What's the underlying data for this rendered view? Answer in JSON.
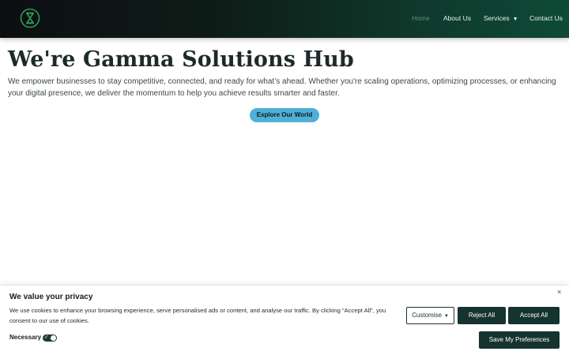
{
  "header": {
    "nav": [
      {
        "label": "Home",
        "active": true
      },
      {
        "label": "About Us",
        "active": false
      },
      {
        "label": "Services",
        "active": false,
        "dropdown": true
      },
      {
        "label": "Contact Us",
        "active": false
      }
    ]
  },
  "hero": {
    "title": "We're Gamma Solutions Hub",
    "text": "We empower businesses to stay competitive, connected, and ready for what’s ahead. Whether you're scaling operations, optimizing processes, or enhancing your digital presence, we deliver the momentum to help you achieve results smarter and faster.",
    "cta_label": "Explore Our World"
  },
  "cookie_banner": {
    "title": "We value your privacy",
    "text": "We use cookies to enhance your browsing experience, serve personalised ads or content, and analyse our traffic. By clicking \"Accept All\", you consent to our use of cookies.",
    "necessary_label": "Necessary",
    "necessary_enabled": true,
    "customise_label": "Customise",
    "reject_label": "Reject All",
    "accept_label": "Accept All",
    "save_label": "Save My Preferences",
    "close_symbol": "×"
  },
  "colors": {
    "accent": "#4eb0d6",
    "dark_green": "#15332f",
    "logo_green": "#2f9a5a"
  }
}
